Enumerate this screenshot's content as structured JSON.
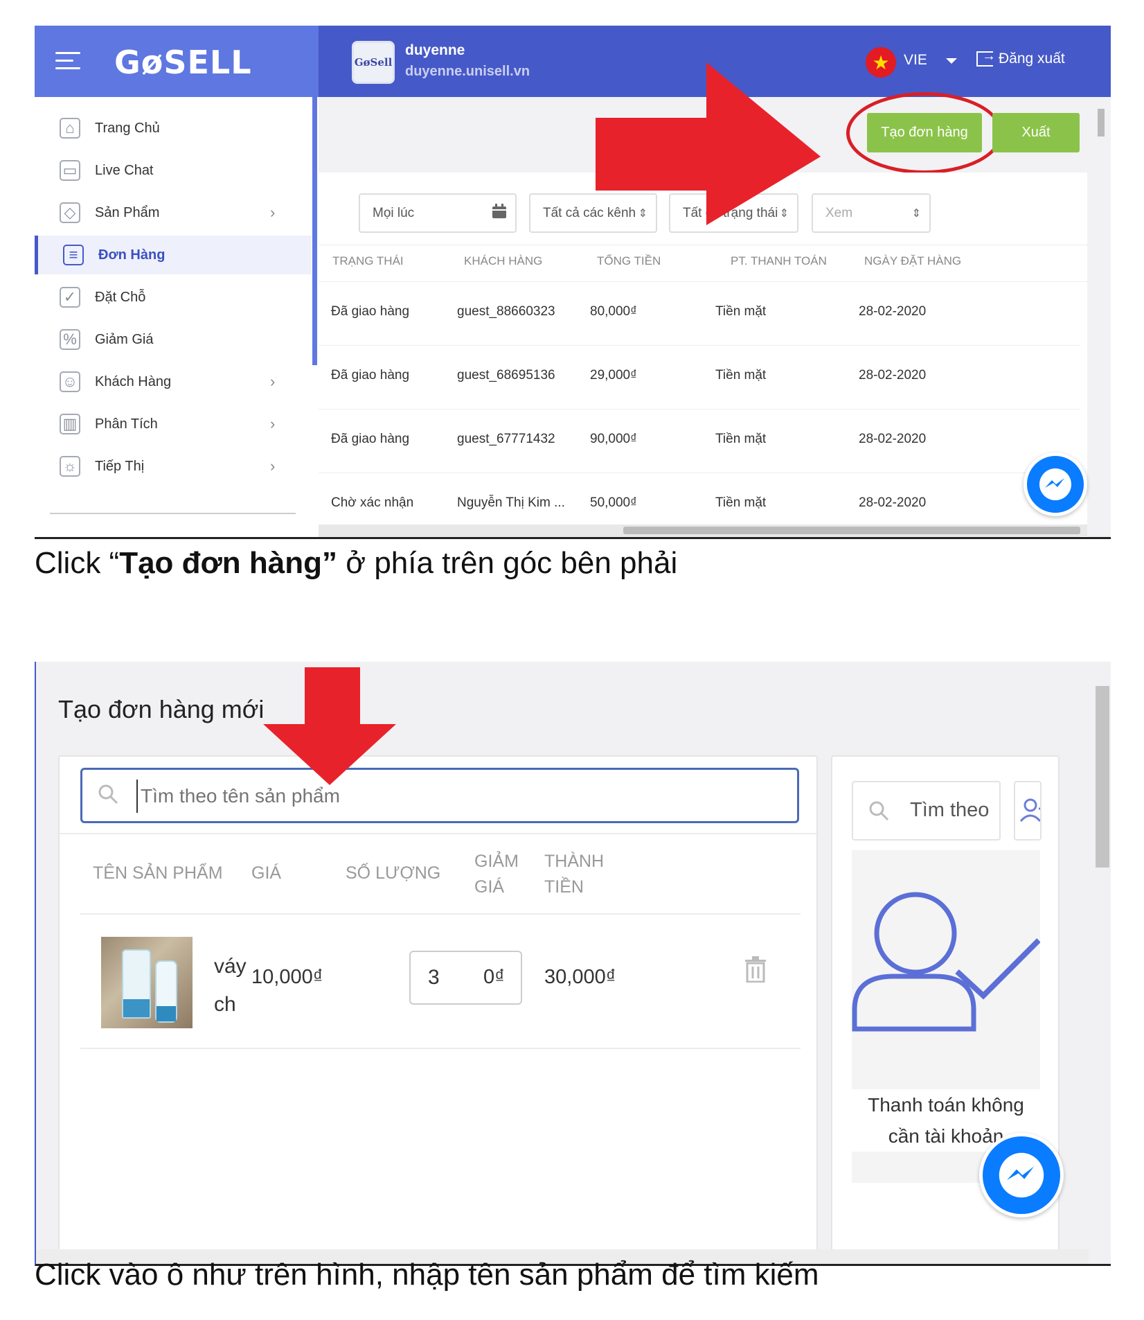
{
  "shot1": {
    "logo": "GøSELL",
    "shop": {
      "avatar_text": "GøSell",
      "name": "duyenne",
      "url": "duyenne.unisell.vn"
    },
    "header": {
      "language": "VIE",
      "logout_label": "Đăng xuất"
    },
    "sidebar": {
      "items": [
        {
          "label": "Trang Chủ",
          "icon": "home-icon",
          "chevron": false
        },
        {
          "label": "Live Chat",
          "icon": "chat-icon",
          "chevron": false
        },
        {
          "label": "Sản Phẩm",
          "icon": "tag-icon",
          "chevron": true
        },
        {
          "label": "Đơn Hàng",
          "icon": "order-icon",
          "chevron": false,
          "active": true
        },
        {
          "label": "Đặt Chỗ",
          "icon": "calendar-check-icon",
          "chevron": false
        },
        {
          "label": "Giảm Giá",
          "icon": "discount-icon",
          "chevron": false
        },
        {
          "label": "Khách Hàng",
          "icon": "customers-icon",
          "chevron": true
        },
        {
          "label": "Phân Tích",
          "icon": "analytics-icon",
          "chevron": true
        },
        {
          "label": "Tiếp Thị",
          "icon": "lightbulb-icon",
          "chevron": true
        }
      ]
    },
    "toolbar": {
      "create_label": "Tạo đơn hàng",
      "export_label": "Xuất"
    },
    "filters": {
      "date": "Mọi lúc",
      "channel": "Tất cả các kênh",
      "status": "Tất cả trạng thái",
      "view": "Xem"
    },
    "table": {
      "headers": [
        "TRẠNG THÁI",
        "KHÁCH HÀNG",
        "TỔNG TIỀN",
        "PT. THANH TOÁN",
        "NGÀY ĐẶT HÀNG"
      ],
      "rows": [
        [
          "Đã giao hàng",
          "guest_88660323",
          "80,000₫",
          "Tiền mặt",
          "28-02-2020"
        ],
        [
          "Đã giao hàng",
          "guest_68695136",
          "29,000₫",
          "Tiền mặt",
          "28-02-2020"
        ],
        [
          "Đã giao hàng",
          "guest_67771432",
          "90,000₫",
          "Tiền mặt",
          "28-02-2020"
        ],
        [
          "Chờ xác nhận",
          "Nguyễn Thị Kim ...",
          "50,000₫",
          "Tiền mặt",
          "28-02-2020"
        ]
      ]
    },
    "colors": {
      "header": "#4659c8",
      "logo_bar": "#5f77e1",
      "button": "#8bc34a",
      "annotation": "#e8222b"
    }
  },
  "caption1": {
    "prefix": "Click “",
    "bold": "Tạo đơn hàng”",
    "suffix": " ở phía trên góc bên phải"
  },
  "shot2": {
    "title": "Tạo đơn hàng mới",
    "search_placeholder": "Tìm theo tên sản phẩm",
    "headers": {
      "name": "TÊN SẢN PHẨM",
      "price": "GIÁ",
      "qty": "SỐ LƯỢNG",
      "discount_1": "GIẢM",
      "discount_2": "GIÁ",
      "total_1": "THÀNH",
      "total_2": "TIỀN"
    },
    "item": {
      "name_1": "váy",
      "name_2": "ch",
      "price": "10,000₫",
      "quantity": "3",
      "discount": "0₫",
      "total": "30,000₫"
    },
    "customer": {
      "search_placeholder": "Tìm theo",
      "guest_line1": "Thanh toán không",
      "guest_line2": "cần tài khoản"
    }
  },
  "caption2": {
    "text": "Click vào ô như trên hình, nhập tên sản phẩm để tìm kiếm"
  }
}
